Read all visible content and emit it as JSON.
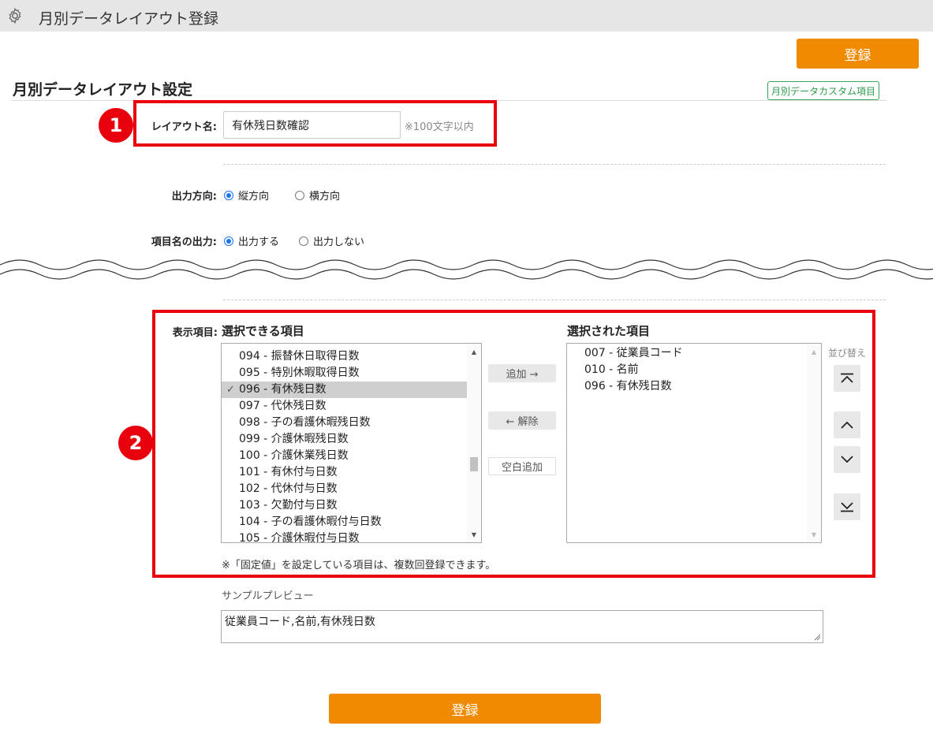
{
  "window": {
    "title": "月別データレイアウト登録",
    "icon": "gear-icon"
  },
  "toolbar": {
    "register_label": "登録"
  },
  "section": {
    "title": "月別データレイアウト設定",
    "custom_link": "月別データカスタム項目"
  },
  "badges": {
    "one": "1",
    "two": "2"
  },
  "layout_name": {
    "label": "レイアウト名:",
    "value": "有休残日数確認",
    "hint": "※100文字以内"
  },
  "output_direction": {
    "label": "出力方向:",
    "options": [
      {
        "label": "縦方向",
        "checked": true
      },
      {
        "label": "横方向",
        "checked": false
      }
    ]
  },
  "item_name_output": {
    "label": "項目名の出力:",
    "options": [
      {
        "label": "出力する",
        "checked": true
      },
      {
        "label": "出力しない",
        "checked": false
      }
    ]
  },
  "display_items": {
    "label": "表示項目:",
    "available_title": "選択できる項目",
    "selected_title": "選択された項目",
    "available_items": [
      {
        "text": "094 - 振替休日取得日数",
        "selected": false
      },
      {
        "text": "095 - 特別休暇取得日数",
        "selected": false
      },
      {
        "text": "096 - 有休残日数",
        "selected": true
      },
      {
        "text": "097 - 代休残日数",
        "selected": false
      },
      {
        "text": "098 - 子の看護休暇残日数",
        "selected": false
      },
      {
        "text": "099 - 介護休暇残日数",
        "selected": false
      },
      {
        "text": "100 - 介護休業残日数",
        "selected": false
      },
      {
        "text": "101 - 有休付与日数",
        "selected": false
      },
      {
        "text": "102 - 代休付与日数",
        "selected": false
      },
      {
        "text": "103 - 欠勤付与日数",
        "selected": false
      },
      {
        "text": "104 - 子の看護休暇付与日数",
        "selected": false
      },
      {
        "text": "105 - 介護休暇付与日数",
        "selected": false
      }
    ],
    "selected_items": [
      "007 - 従業員コード",
      "010 - 名前",
      "096 - 有休残日数"
    ],
    "add_label": "追加 →",
    "remove_label": "← 解除",
    "blank_label": "空白追加",
    "sort_label": "並び替え",
    "note": "※「固定値」を設定している項目は、複数回登録できます。"
  },
  "preview": {
    "label": "サンプルプレビュー",
    "value": "従業員コード,名前,有休残日数"
  },
  "colors": {
    "accent": "#f08a00",
    "annotation": "#e8000d",
    "link": "#2c9a4c",
    "radio": "#1a73e8"
  }
}
